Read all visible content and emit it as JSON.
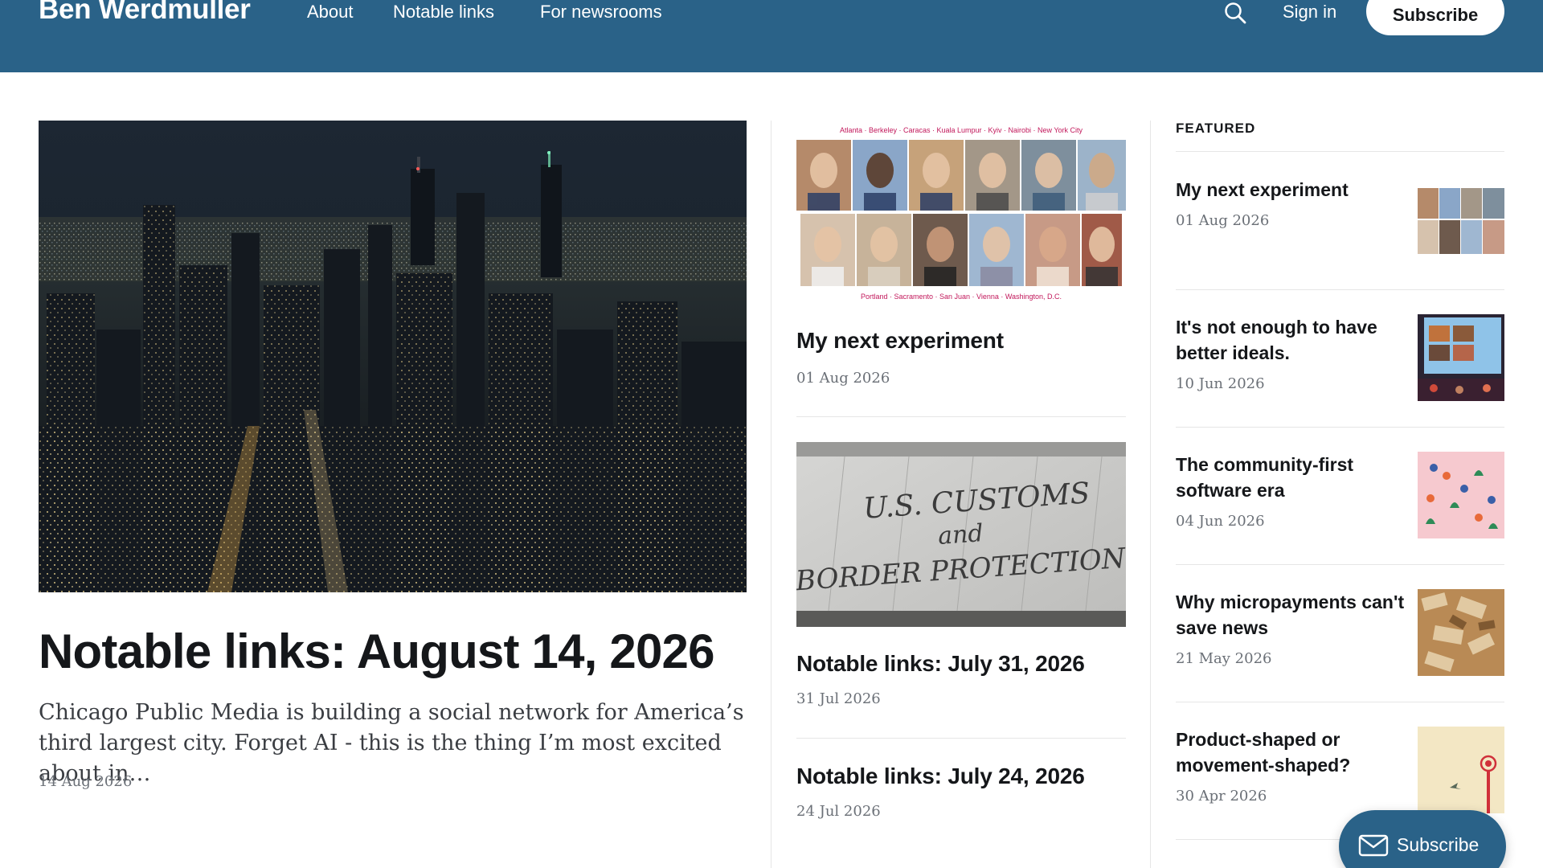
{
  "header": {
    "brand": "Ben Werdmuller",
    "nav": [
      "About",
      "Notable links",
      "For newsrooms"
    ],
    "search_icon": "search-icon",
    "signin": "Sign in",
    "subscribe": "Subscribe"
  },
  "lead": {
    "title": "Notable links: August 14, 2026",
    "excerpt": "Chicago Public Media is building a social network for America’s third largest city. Forget AI - this is the thing I’m most excited about in…",
    "date": "14 Aug 2026"
  },
  "middle": [
    {
      "title": "My next experiment",
      "date": "01 Aug 2026",
      "img_caption_top": "Atlanta · Berkeley · Caracas · Kuala Lumpur · Kyiv · Nairobi · New York City",
      "img_caption_bottom": "Portland · Sacramento · San Juan · Vienna · Washington, D.C."
    },
    {
      "title": "Notable links: July 31, 2026",
      "date": "31 Jul 2026",
      "img_sign_line1": "U.S. CUSTOMS",
      "img_sign_line2": "and",
      "img_sign_line3": "BORDER PROTECTION"
    },
    {
      "title": "Notable links: July 24, 2026",
      "date": "24 Jul 2026"
    }
  ],
  "featured": {
    "label": "FEATURED",
    "items": [
      {
        "title": "My next experiment",
        "date": "01 Aug 2026"
      },
      {
        "title": "It's not enough to have better ideals.",
        "date": "10 Jun 2026"
      },
      {
        "title": "The community-first software era",
        "date": "04 Jun 2026"
      },
      {
        "title": "Why micropayments can't save news",
        "date": "21 May 2026"
      },
      {
        "title": "Product-shaped or movement-shaped?",
        "date": "30 Apr 2026"
      }
    ]
  },
  "float_subscribe": {
    "label": "Subscribe",
    "icon": "mail-icon"
  },
  "colors": {
    "header_bg": "#2a6288",
    "text": "#15171a",
    "muted": "#6b7077"
  }
}
